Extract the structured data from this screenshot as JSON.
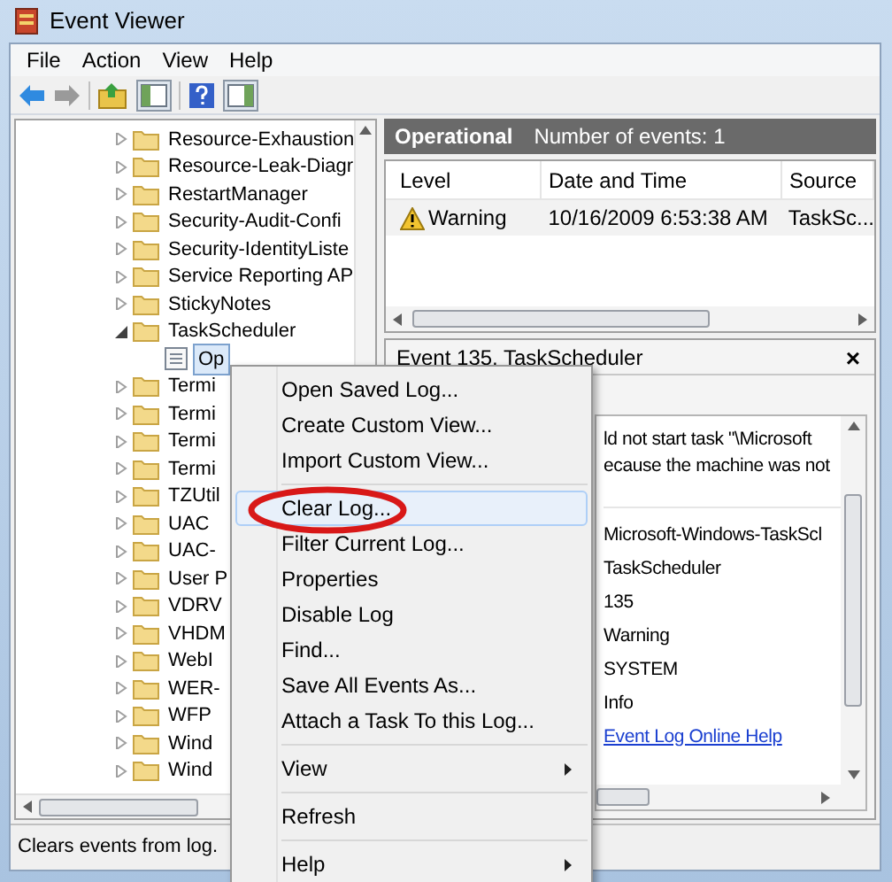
{
  "window": {
    "title": "Event Viewer"
  },
  "menu_bar": [
    "File",
    "Action",
    "View",
    "Help"
  ],
  "tree": [
    {
      "label": "Resource-Exhaustion",
      "expanded": false,
      "selected": false
    },
    {
      "label": "Resource-Leak-Diagr",
      "expanded": false,
      "selected": false
    },
    {
      "label": "RestartManager",
      "expanded": false,
      "selected": false
    },
    {
      "label": "Security-Audit-Confi",
      "expanded": false,
      "selected": false
    },
    {
      "label": "Security-IdentityListe",
      "expanded": false,
      "selected": false
    },
    {
      "label": "Service Reporting AP",
      "expanded": false,
      "selected": false
    },
    {
      "label": "StickyNotes",
      "expanded": false,
      "selected": false
    },
    {
      "label": "TaskScheduler",
      "expanded": true,
      "selected": false,
      "children": [
        {
          "label": "Op",
          "selected": true
        }
      ]
    },
    {
      "label": "Termi",
      "expanded": false,
      "selected": false
    },
    {
      "label": "Termi",
      "expanded": false,
      "selected": false
    },
    {
      "label": "Termi",
      "expanded": false,
      "selected": false
    },
    {
      "label": "Termi",
      "expanded": false,
      "selected": false
    },
    {
      "label": "TZUtil",
      "expanded": false,
      "selected": false
    },
    {
      "label": "UAC",
      "expanded": false,
      "selected": false
    },
    {
      "label": "UAC-",
      "expanded": false,
      "selected": false
    },
    {
      "label": "User P",
      "expanded": false,
      "selected": false
    },
    {
      "label": "VDRV",
      "expanded": false,
      "selected": false
    },
    {
      "label": "VHDM",
      "expanded": false,
      "selected": false
    },
    {
      "label": "WebI",
      "expanded": false,
      "selected": false
    },
    {
      "label": "WER-",
      "expanded": false,
      "selected": false
    },
    {
      "label": "WFP",
      "expanded": false,
      "selected": false
    },
    {
      "label": "Wind",
      "expanded": false,
      "selected": false
    },
    {
      "label": "Wind",
      "expanded": false,
      "selected": false
    }
  ],
  "log_header": {
    "title": "Operational",
    "count": "Number of events: 1"
  },
  "events_table": {
    "columns": [
      "Level",
      "Date and Time",
      "Source"
    ],
    "rows": [
      {
        "kind": "warning",
        "level": "Warning",
        "date": "10/16/2009 6:53:38 AM",
        "source": "TaskSc..."
      }
    ]
  },
  "event_detail": {
    "title": "Event 135, TaskScheduler",
    "close": "×",
    "description": [
      "ld not start task \"\\Microsoft",
      "ecause the machine was not"
    ],
    "fields": [
      "Microsoft-Windows-TaskScl",
      "TaskScheduler",
      "135",
      "Warning",
      "SYSTEM",
      "Info"
    ],
    "link": "Event Log Online Help"
  },
  "context_menu": [
    {
      "kind": "item",
      "label": "Open Saved Log...",
      "submenu": false,
      "selected": false,
      "circled": false
    },
    {
      "kind": "item",
      "label": "Create Custom View...",
      "submenu": false,
      "selected": false,
      "circled": false
    },
    {
      "kind": "item",
      "label": "Import Custom View...",
      "submenu": false,
      "selected": false,
      "circled": false
    },
    {
      "kind": "separator"
    },
    {
      "kind": "item",
      "label": "Clear Log...",
      "submenu": false,
      "selected": true,
      "circled": true
    },
    {
      "kind": "item",
      "label": "Filter Current Log...",
      "submenu": false,
      "selected": false,
      "circled": false
    },
    {
      "kind": "item",
      "label": "Properties",
      "submenu": false,
      "selected": false,
      "circled": false
    },
    {
      "kind": "item",
      "label": "Disable Log",
      "submenu": false,
      "selected": false,
      "circled": false
    },
    {
      "kind": "item",
      "label": "Find...",
      "submenu": false,
      "selected": false,
      "circled": false
    },
    {
      "kind": "item",
      "label": "Save All Events As...",
      "submenu": false,
      "selected": false,
      "circled": false
    },
    {
      "kind": "item",
      "label": "Attach a Task To this Log...",
      "submenu": false,
      "selected": false,
      "circled": false
    },
    {
      "kind": "separator"
    },
    {
      "kind": "item",
      "label": "View",
      "submenu": true,
      "selected": false,
      "circled": false
    },
    {
      "kind": "separator"
    },
    {
      "kind": "item",
      "label": "Refresh",
      "submenu": false,
      "selected": false,
      "circled": false
    },
    {
      "kind": "separator"
    },
    {
      "kind": "item",
      "label": "Help",
      "submenu": true,
      "selected": false,
      "circled": false
    }
  ],
  "status_bar": "Clears events from log."
}
